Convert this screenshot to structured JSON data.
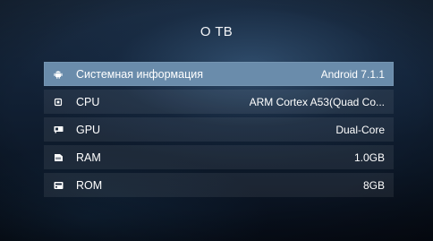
{
  "header": {
    "title": "О ТВ"
  },
  "rows": [
    {
      "icon": "android-icon",
      "label": "Системная информация",
      "value": "Android 7.1.1",
      "selected": true
    },
    {
      "icon": "cpu-chip-icon",
      "label": "CPU",
      "value": "ARM Cortex A53(Quad Co...",
      "selected": false
    },
    {
      "icon": "gpu-card-icon",
      "label": "GPU",
      "value": "Dual-Core",
      "selected": false
    },
    {
      "icon": "ram-module-icon",
      "label": "RAM",
      "value": "1.0GB",
      "selected": false
    },
    {
      "icon": "rom-storage-icon",
      "label": "ROM",
      "value": "8GB",
      "selected": false
    }
  ],
  "colors": {
    "selected_row": "#6a8cab",
    "row_background": "rgba(255,255,255,0.07)",
    "text": "#ffffff"
  }
}
